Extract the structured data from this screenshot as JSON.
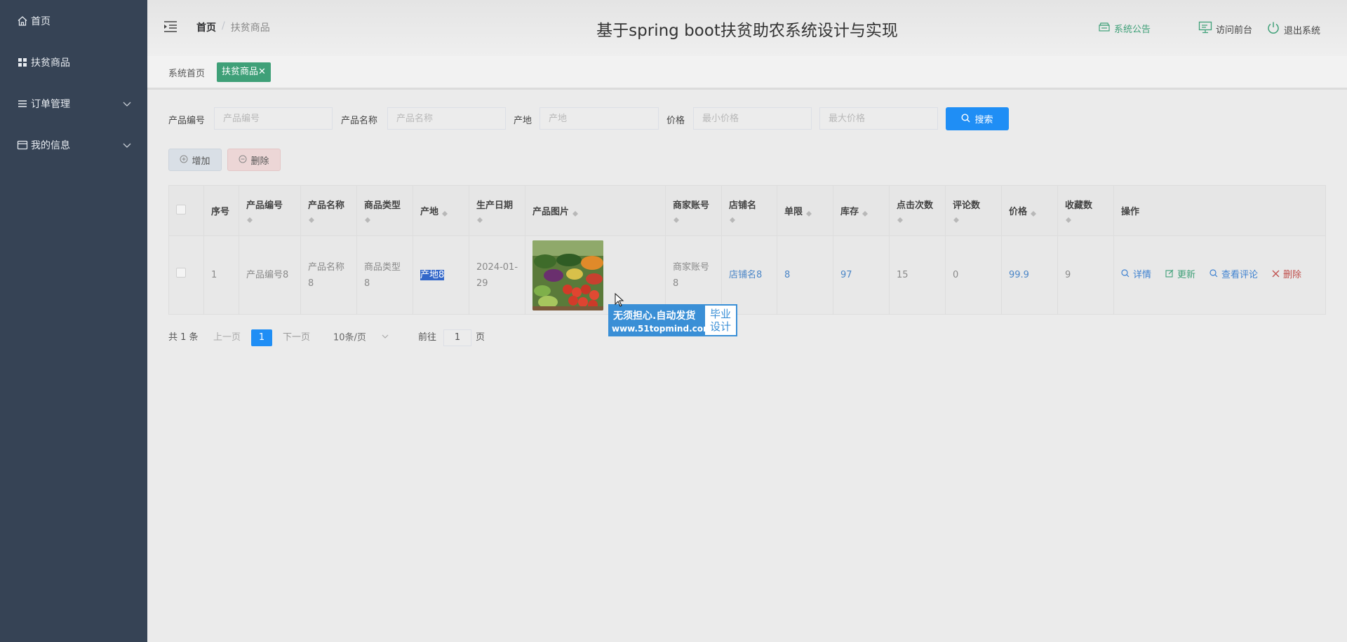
{
  "sidebar": {
    "items": [
      {
        "label": "首页",
        "icon": "home-icon"
      },
      {
        "label": "扶贫商品",
        "icon": "grid-icon"
      },
      {
        "label": "订单管理",
        "icon": "list-icon"
      },
      {
        "label": "我的信息",
        "icon": "card-icon"
      }
    ]
  },
  "header": {
    "breadcrumb": {
      "home": "首页",
      "sep": "/",
      "current": "扶贫商品"
    },
    "title": "基于spring boot扶贫助农系统设计与实现",
    "notice": "系统公告",
    "visit": "访问前台",
    "logout": "退出系统"
  },
  "tags": {
    "home": "系统首页",
    "active": "扶贫商品",
    "close": "✕"
  },
  "search": {
    "code_label": "产品编号",
    "code_placeholder": "产品编号",
    "name_label": "产品名称",
    "name_placeholder": "产品名称",
    "origin_label": "产地",
    "origin_placeholder": "产地",
    "price_label": "价格",
    "min_placeholder": "最小价格",
    "max_placeholder": "最大价格",
    "button": "搜索"
  },
  "actions": {
    "add": "增加",
    "delete": "删除"
  },
  "table": {
    "headers": {
      "index": "序号",
      "code": "产品编号",
      "name": "产品名称",
      "type": "商品类型",
      "origin": "产地",
      "date": "生产日期",
      "image": "产品图片",
      "merchant": "商家账号",
      "shop": "店铺名",
      "limit": "单限",
      "stock": "库存",
      "clicks": "点击次数",
      "comments": "评论数",
      "price": "价格",
      "favorites": "收藏数",
      "ops": "操作"
    },
    "rows": [
      {
        "index": "1",
        "code": "产品编号8",
        "name": "产品名称8",
        "type": "商品类型8",
        "origin": "产地8",
        "date": "2024-01-29",
        "merchant": "商家账号8",
        "shop": "店铺名8",
        "limit": "8",
        "stock": "97",
        "clicks": "15",
        "comments": "0",
        "price": "99.9",
        "favorites": "9",
        "ops": {
          "detail": "详情",
          "update": "更新",
          "reviews": "查看评论",
          "delete": "删除"
        }
      }
    ]
  },
  "pagination": {
    "total": "共 1 条",
    "prev": "上一页",
    "page": "1",
    "next": "下一页",
    "size": "10条/页",
    "goto": "前往",
    "goto_value": "1",
    "unit": "页"
  },
  "watermark": {
    "line1": "无须担心.自动发货",
    "line2": "www.51topmind.com",
    "right1": "毕业",
    "right2": "设计"
  },
  "colors": {
    "sidebar": "#364355",
    "accent_green": "#3fa078",
    "primary": "#1f8ef5",
    "link": "#3f82d0"
  }
}
